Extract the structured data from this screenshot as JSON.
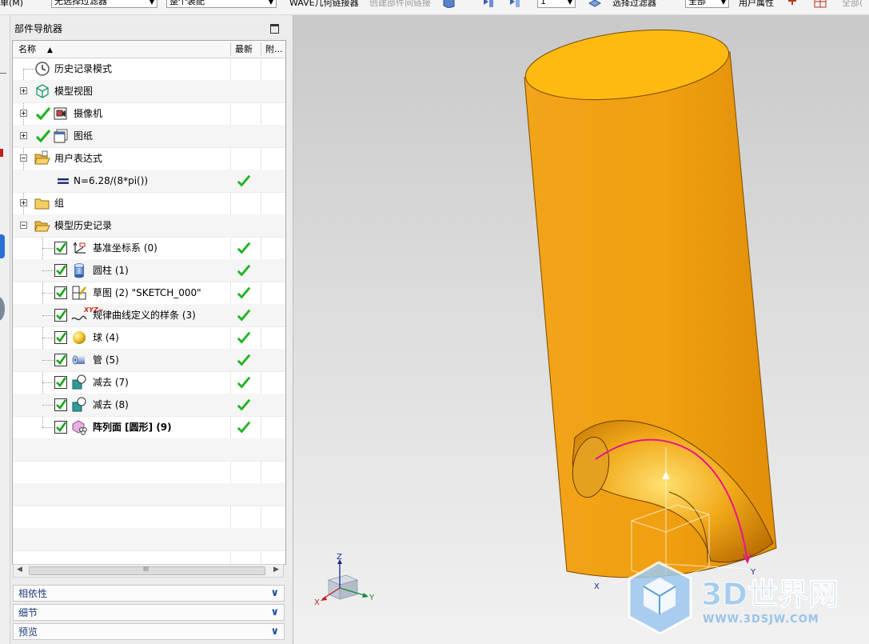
{
  "toolbar": {
    "menu_fragment": "单(M)",
    "type_filter": "无选择过滤器",
    "scope": "整个装配",
    "wave_label": "WAVE几何链接器",
    "interpart_label": "创建部件间链接",
    "layer_value": "1",
    "selection_filter": "选择过滤器",
    "filter_all": "全部",
    "user_attr": "用户属性",
    "right_fragment": "全部("
  },
  "navigator": {
    "title": "部件导航器",
    "columns": {
      "name": "名称",
      "latest": "最新",
      "attach": "附..."
    },
    "rows": [
      {
        "label": "历史记录模式",
        "icon": "clock-icon",
        "latest": false
      },
      {
        "label": "模型视图",
        "icon": "model-view-cube-icon",
        "latest": false
      },
      {
        "label": "摄像机",
        "icon": "camera-icon",
        "latest": false
      },
      {
        "label": "图纸",
        "icon": "drawing-sheet-icon",
        "latest": false
      },
      {
        "label": "用户表达式",
        "icon": "open-folder-icon",
        "latest": false
      },
      {
        "label": "N=6.28/(8*pi())",
        "icon": "expression-equals-icon",
        "latest": true
      },
      {
        "label": "组",
        "icon": "folder-icon",
        "latest": false
      },
      {
        "label": "模型历史记录",
        "icon": "open-folder-icon",
        "latest": false
      },
      {
        "label": "基准坐标系 (0)",
        "icon": "datum-csys-icon",
        "latest": true
      },
      {
        "label": "圆柱 (1)",
        "icon": "cylinder-icon",
        "latest": true
      },
      {
        "label": "草图 (2) \"SKETCH_000\"",
        "icon": "sketch-icon",
        "latest": true
      },
      {
        "label": "规律曲线定义的样条 (3)",
        "icon": "law-curve-spline-icon",
        "latest": true
      },
      {
        "label": "球 (4)",
        "icon": "sphere-icon",
        "latest": true
      },
      {
        "label": "管 (5)",
        "icon": "tube-icon",
        "latest": true
      },
      {
        "label": "减去 (7)",
        "icon": "subtract-icon",
        "latest": true
      },
      {
        "label": "减去 (8)",
        "icon": "subtract-icon",
        "latest": true
      },
      {
        "label": "阵列面 [圆形] (9)",
        "icon": "pattern-face-icon",
        "latest": true
      }
    ],
    "sections": [
      "相依性",
      "细节",
      "预览"
    ],
    "scroll_grip": "III"
  },
  "viewport": {
    "triad": {
      "x": "X",
      "y": "Y",
      "z": "Z"
    },
    "watermark_text": "3D世界网",
    "watermark_url": "WWW.3DSJW.COM"
  },
  "colors": {
    "part_orange": "#f0a010",
    "check_green": "#22b422",
    "curve_magenta": "#e6158c",
    "watermark_blue": "#5aa0d8"
  }
}
